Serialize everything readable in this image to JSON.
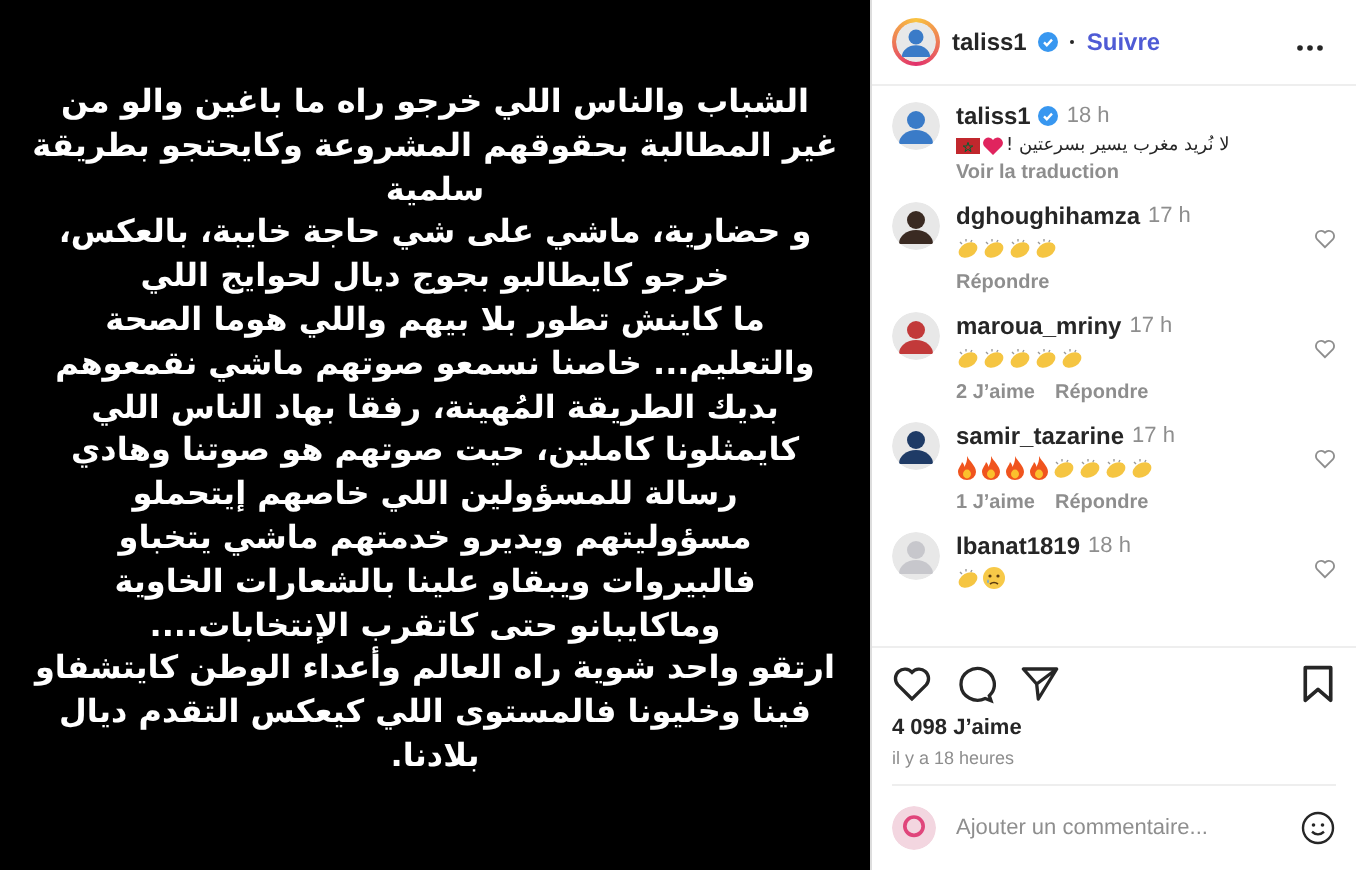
{
  "post_image": {
    "lines": [
      "الشباب والناس اللي خرجو راه ما باغين والو من",
      "غير المطالبة بحقوقهم المشروعة وكايحتجو بطريقة",
      "سلمية",
      "و حضارية، ماشي على شي حاجة خايبة، بالعكس،",
      "خرجو كايطالبو بجوج ديال لحوايج اللي",
      "ما كاينش تطور بلا بيهم واللي هوما الصحة",
      "والتعليم... خاصنا نسمعو صوتهم ماشي نقمعوهم",
      "بديك الطريقة المُهينة، رفقا بهاد الناس اللي",
      "كايمثلونا كاملين، حيت صوتهم هو صوتنا وهادي",
      "رسالة للمسؤولين اللي خاصهم إيتحملو",
      "مسؤوليتهم ويديرو خدمتهم ماشي يتخباو",
      "فالبيروات ويبقاو علينا بالشعارات الخاوية",
      "وماكايبانو حتى كاتقرب الإنتخابات....",
      "ارتقو واحد شوية راه العالم وأعداء الوطن كايتشفاو",
      "فينا وخليونا فالمستوى اللي كيعكس التقدم ديال",
      "بلادنا."
    ]
  },
  "header": {
    "username": "taliss1",
    "verified": true,
    "follow": "Suivre"
  },
  "caption": {
    "username": "taliss1",
    "verified": true,
    "time": "18 h",
    "text": "لا نُريد مغرب يسير بسرعتين !",
    "emojis": [
      {
        "kind": "heart"
      },
      {
        "kind": "flag"
      }
    ],
    "translate": "Voir la traduction"
  },
  "comments": [
    {
      "username": "dghoughihamza",
      "time": "17 h",
      "emojis": [
        {
          "kind": "clap"
        },
        {
          "kind": "clap"
        },
        {
          "kind": "clap"
        },
        {
          "kind": "clap"
        }
      ],
      "reply": "Répondre"
    },
    {
      "username": "maroua_mriny",
      "time": "17 h",
      "emojis": [
        {
          "kind": "clap"
        },
        {
          "kind": "clap"
        },
        {
          "kind": "clap"
        },
        {
          "kind": "clap"
        },
        {
          "kind": "clap"
        }
      ],
      "likes": "2 J’aime",
      "reply": "Répondre"
    },
    {
      "username": "samir_tazarine",
      "time": "17 h",
      "emojis": [
        {
          "kind": "fire"
        },
        {
          "kind": "fire"
        },
        {
          "kind": "fire"
        },
        {
          "kind": "fire"
        },
        {
          "kind": "clap"
        },
        {
          "kind": "clap"
        },
        {
          "kind": "clap"
        },
        {
          "kind": "clap"
        }
      ],
      "likes": "1 J’aime",
      "reply": "Répondre"
    },
    {
      "username": "lbanat1819",
      "time": "18 h",
      "emojis": [
        {
          "kind": "clap"
        },
        {
          "kind": "tear"
        }
      ]
    }
  ],
  "likes": "4 098 J’aime",
  "posted": "il y a 18 heures",
  "comment_field": {
    "placeholder": "Ajouter un commentaire..."
  }
}
